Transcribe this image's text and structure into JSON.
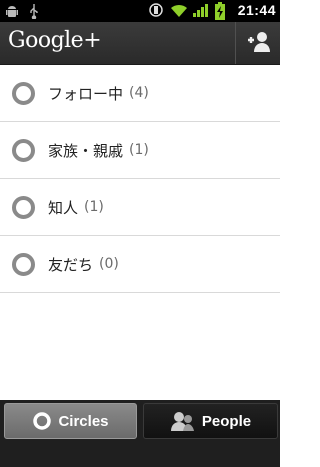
{
  "statusbar": {
    "time": "21:44",
    "icons": [
      "android-debug-icon",
      "usb-icon",
      "screen-rotation-icon",
      "wifi-icon",
      "signal-icon",
      "battery-charging-icon"
    ]
  },
  "actionbar": {
    "brand": "Google+",
    "add_person_icon": "add-person-icon"
  },
  "circles": [
    {
      "label": "フォロー中",
      "count": "(4)"
    },
    {
      "label": "家族・親戚",
      "count": "(1)"
    },
    {
      "label": "知人",
      "count": "(1)"
    },
    {
      "label": "友だち",
      "count": "(0)"
    }
  ],
  "tabs": {
    "circles_label": "Circles",
    "people_label": "People",
    "selected": "Circles"
  }
}
